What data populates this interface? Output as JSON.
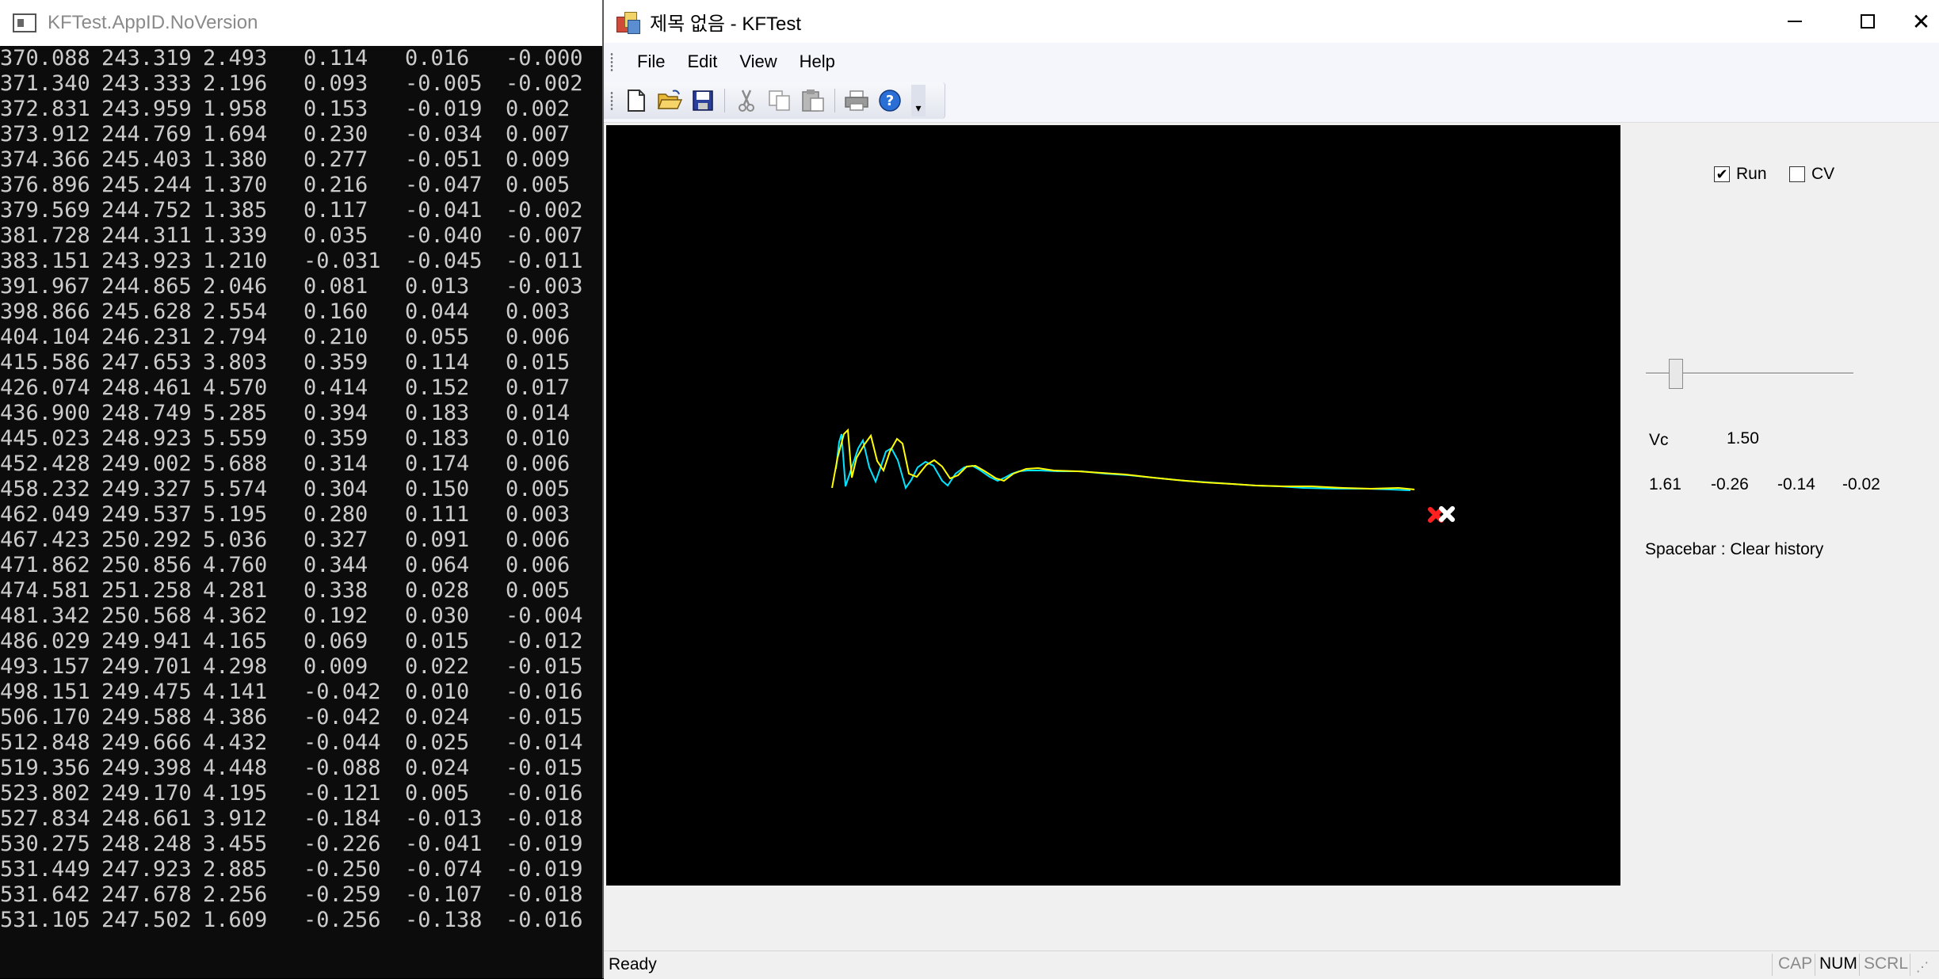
{
  "console": {
    "title": "KFTest.AppID.NoVersion",
    "rows": [
      [
        "370.088",
        "243.319",
        "2.493",
        "0.114",
        "0.016",
        "-0.000"
      ],
      [
        "371.340",
        "243.333",
        "2.196",
        "0.093",
        "-0.005",
        "-0.002"
      ],
      [
        "372.831",
        "243.959",
        "1.958",
        "0.153",
        "-0.019",
        "0.002"
      ],
      [
        "373.912",
        "244.769",
        "1.694",
        "0.230",
        "-0.034",
        "0.007"
      ],
      [
        "374.366",
        "245.403",
        "1.380",
        "0.277",
        "-0.051",
        "0.009"
      ],
      [
        "376.896",
        "245.244",
        "1.370",
        "0.216",
        "-0.047",
        "0.005"
      ],
      [
        "379.569",
        "244.752",
        "1.385",
        "0.117",
        "-0.041",
        "-0.002"
      ],
      [
        "381.728",
        "244.311",
        "1.339",
        "0.035",
        "-0.040",
        "-0.007"
      ],
      [
        "383.151",
        "243.923",
        "1.210",
        "-0.031",
        "-0.045",
        "-0.011"
      ],
      [
        "391.967",
        "244.865",
        "2.046",
        "0.081",
        "0.013",
        "-0.003"
      ],
      [
        "398.866",
        "245.628",
        "2.554",
        "0.160",
        "0.044",
        "0.003"
      ],
      [
        "404.104",
        "246.231",
        "2.794",
        "0.210",
        "0.055",
        "0.006"
      ],
      [
        "415.586",
        "247.653",
        "3.803",
        "0.359",
        "0.114",
        "0.015"
      ],
      [
        "426.074",
        "248.461",
        "4.570",
        "0.414",
        "0.152",
        "0.017"
      ],
      [
        "436.900",
        "248.749",
        "5.285",
        "0.394",
        "0.183",
        "0.014"
      ],
      [
        "445.023",
        "248.923",
        "5.559",
        "0.359",
        "0.183",
        "0.010"
      ],
      [
        "452.428",
        "249.002",
        "5.688",
        "0.314",
        "0.174",
        "0.006"
      ],
      [
        "458.232",
        "249.327",
        "5.574",
        "0.304",
        "0.150",
        "0.005"
      ],
      [
        "462.049",
        "249.537",
        "5.195",
        "0.280",
        "0.111",
        "0.003"
      ],
      [
        "467.423",
        "250.292",
        "5.036",
        "0.327",
        "0.091",
        "0.006"
      ],
      [
        "471.862",
        "250.856",
        "4.760",
        "0.344",
        "0.064",
        "0.006"
      ],
      [
        "474.581",
        "251.258",
        "4.281",
        "0.338",
        "0.028",
        "0.005"
      ],
      [
        "481.342",
        "250.568",
        "4.362",
        "0.192",
        "0.030",
        "-0.004"
      ],
      [
        "486.029",
        "249.941",
        "4.165",
        "0.069",
        "0.015",
        "-0.012"
      ],
      [
        "493.157",
        "249.701",
        "4.298",
        "0.009",
        "0.022",
        "-0.015"
      ],
      [
        "498.151",
        "249.475",
        "4.141",
        "-0.042",
        "0.010",
        "-0.016"
      ],
      [
        "506.170",
        "249.588",
        "4.386",
        "-0.042",
        "0.024",
        "-0.015"
      ],
      [
        "512.848",
        "249.666",
        "4.432",
        "-0.044",
        "0.025",
        "-0.014"
      ],
      [
        "519.356",
        "249.398",
        "4.448",
        "-0.088",
        "0.024",
        "-0.015"
      ],
      [
        "523.802",
        "249.170",
        "4.195",
        "-0.121",
        "0.005",
        "-0.016"
      ],
      [
        "527.834",
        "248.661",
        "3.912",
        "-0.184",
        "-0.013",
        "-0.018"
      ],
      [
        "530.275",
        "248.248",
        "3.455",
        "-0.226",
        "-0.041",
        "-0.019"
      ],
      [
        "531.449",
        "247.923",
        "2.885",
        "-0.250",
        "-0.074",
        "-0.019"
      ],
      [
        "531.642",
        "247.678",
        "2.256",
        "-0.259",
        "-0.107",
        "-0.018"
      ],
      [
        "531.105",
        "247.502",
        "1.609",
        "-0.256",
        "-0.138",
        "-0.016"
      ]
    ]
  },
  "window": {
    "title": "제목 없음 - KFTest",
    "minimize_glyph": "—",
    "maximize_glyph": "☐",
    "close_glyph": "✕"
  },
  "menu": {
    "items": [
      "File",
      "Edit",
      "View",
      "Help"
    ]
  },
  "toolbar": {
    "buttons": [
      "new-icon",
      "open-icon",
      "save-icon",
      "cut-icon",
      "copy-icon",
      "paste-icon",
      "print-icon",
      "help-icon"
    ],
    "overflow_glyph": "▾"
  },
  "panel": {
    "run_label": "Run",
    "run_checked": true,
    "cv_label": "CV",
    "cv_checked": false,
    "slider_level": 0.12,
    "vc_label": "Vc",
    "vc_value": "1.50",
    "values": [
      "1.61",
      "-0.26",
      "-0.14",
      "-0.02"
    ],
    "hint": "Spacebar : Clear history"
  },
  "plot": {
    "background": "#000000",
    "measured_color": "#00e5ff",
    "filtered_color": "#ffff00",
    "marker_measured_color": "#ff2020",
    "marker_estimate_color": "#ffffff"
  },
  "status": {
    "text": "Ready",
    "indicators": [
      {
        "label": "CAP",
        "active": false
      },
      {
        "label": "NUM",
        "active": true
      },
      {
        "label": "SCRL",
        "active": false
      }
    ]
  }
}
